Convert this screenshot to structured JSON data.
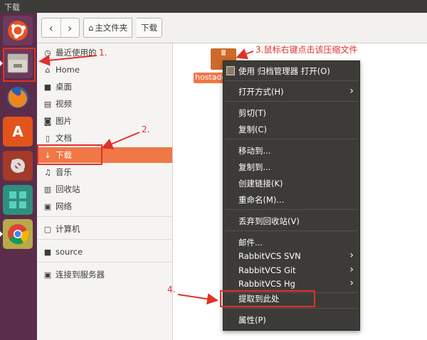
{
  "window": {
    "title": "下载"
  },
  "toolbar": {
    "back_icon": "chevron-left-icon",
    "forward_icon": "chevron-right-icon",
    "breadcrumb": [
      {
        "label": "主文件夹",
        "icon": "home-icon"
      },
      {
        "label": "下载"
      }
    ]
  },
  "launcher": {
    "apps": [
      {
        "name": "ubuntu-dash"
      },
      {
        "name": "files"
      },
      {
        "name": "firefox"
      },
      {
        "name": "software-center"
      },
      {
        "name": "system-settings"
      },
      {
        "name": "workspaces"
      },
      {
        "name": "chrome"
      }
    ]
  },
  "sidebar": {
    "items": [
      {
        "label": "最近使用的",
        "icon": "clock-icon"
      },
      {
        "label": "Home",
        "icon": "home-icon"
      },
      {
        "label": "桌面",
        "icon": "folder-icon"
      },
      {
        "label": "视频",
        "icon": "video-icon"
      },
      {
        "label": "图片",
        "icon": "camera-icon"
      },
      {
        "label": "文档",
        "icon": "document-icon"
      },
      {
        "label": "下载",
        "icon": "download-icon",
        "active": true
      },
      {
        "label": "音乐",
        "icon": "music-icon"
      },
      {
        "label": "回收站",
        "icon": "trash-icon"
      },
      {
        "label": "网络",
        "icon": "network-icon"
      },
      {
        "label": "计算机",
        "icon": "computer-icon"
      },
      {
        "label": "source",
        "icon": "folder-icon"
      },
      {
        "label": "连接到服务器",
        "icon": "server-icon"
      }
    ]
  },
  "file": {
    "name": "hostadd"
  },
  "context_menu": {
    "items": [
      {
        "label": "使用 归档管理器 打开(O)",
        "icon": "archive-manager-icon"
      },
      {
        "label": "打开方式(H)",
        "submenu": true
      },
      {
        "label": "剪切(T)"
      },
      {
        "label": "复制(C)"
      },
      {
        "label": "移动到..."
      },
      {
        "label": "复制到..."
      },
      {
        "label": "创建链接(K)"
      },
      {
        "label": "重命名(M)..."
      },
      {
        "label": "丢弃到回收站(V)"
      },
      {
        "label": "邮件..."
      },
      {
        "label": "RabbitVCS SVN",
        "submenu": true
      },
      {
        "label": "RabbitVCS Git",
        "submenu": true
      },
      {
        "label": "RabbitVCS Hg",
        "submenu": true
      },
      {
        "label": "提取到此处"
      },
      {
        "label": "属性(P)"
      }
    ]
  },
  "annotations": {
    "a1": "1.",
    "a2": "2.",
    "a3": "3.鼠标右键点击该压缩文件",
    "a4": "4."
  },
  "colors": {
    "accent": "#f07746",
    "annotation": "#e0312a",
    "menu_bg": "#3c3b37",
    "launcher_bg": "#5a2e4a"
  }
}
